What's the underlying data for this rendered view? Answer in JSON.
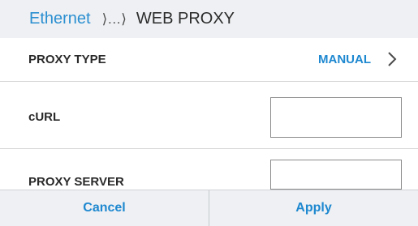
{
  "breadcrumb": {
    "parent": "Ethernet",
    "separator": "⟩…⟩",
    "current": "WEB PROXY"
  },
  "settings": {
    "proxy_type": {
      "label": "PROXY TYPE",
      "value": "MANUAL",
      "icon": "chevron-right-icon"
    },
    "curl": {
      "label": "cURL",
      "value": ""
    },
    "proxy_server": {
      "label": "PROXY SERVER",
      "value": ""
    }
  },
  "footer": {
    "cancel_label": "Cancel",
    "apply_label": "Apply"
  },
  "colors": {
    "accent": "#1e88d0",
    "header_bg": "#eef0f3",
    "divider": "#d6d6d6"
  }
}
